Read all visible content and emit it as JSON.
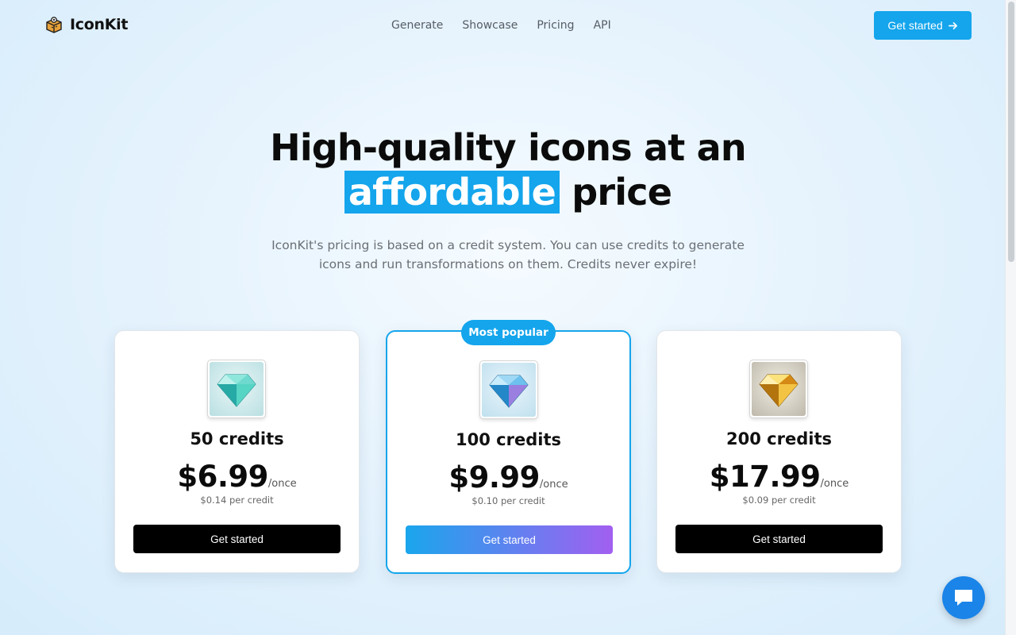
{
  "nav": {
    "brand": "IconKit",
    "links": [
      "Generate",
      "Showcase",
      "Pricing",
      "API"
    ],
    "cta_label": "Get started"
  },
  "hero": {
    "title_line1": "High-quality icons at an",
    "title_highlight": "affordable",
    "title_end": "price",
    "subtitle": "IconKit's pricing is based on a credit system. You can use credits to generate icons and run transformations on them. Credits never expire!"
  },
  "plans": [
    {
      "credits": "50 credits",
      "price": "$6.99",
      "period": "/once",
      "per_credit": "$0.14 per credit",
      "cta": "Get started",
      "gem": "teal-diamond-icon"
    },
    {
      "credits": "100 credits",
      "price": "$9.99",
      "period": "/once",
      "per_credit": "$0.10 per credit",
      "cta": "Get started",
      "badge": "Most popular",
      "gem": "blue-diamond-icon"
    },
    {
      "credits": "200 credits",
      "price": "$17.99",
      "period": "/once",
      "per_credit": "$0.09 per credit",
      "cta": "Get started",
      "gem": "gold-diamond-icon"
    }
  ],
  "colors": {
    "accent": "#14a5ec",
    "chat": "#1a84e8"
  }
}
